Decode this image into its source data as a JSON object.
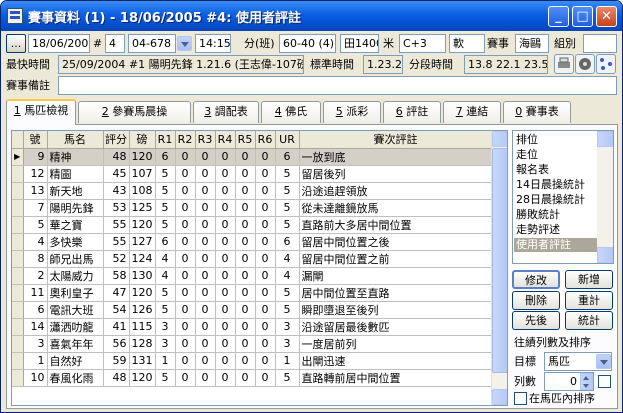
{
  "window": {
    "title": "賽事資料 (1) - 18/06/2005 #4: 使用者評註",
    "minimize": "_",
    "maximize": "□",
    "close": "✕"
  },
  "race_info": {
    "nav_button": "...",
    "date": "18/06/2005",
    "race_no_label": "#",
    "race_no": "4",
    "race_code": "04-678",
    "time": "14:15",
    "class_label": "分(班)",
    "class_value": "60-40 (4)",
    "distance": "田1400",
    "meter_label": "米",
    "course": "C+3",
    "going": "軟",
    "event_label": "賽事",
    "event_value": "海鷗",
    "group_label": "組別",
    "group_value": ""
  },
  "record": {
    "fastest_label": "最快時間",
    "fastest_value": "25/09/2004 #1 陽明先鋒 1.21.6 (王志偉-107磅)",
    "standard_label": "標準時間",
    "standard_value": "1.23.2",
    "sectional_label": "分段時間",
    "sectional_value": "13.8  22.1  23.5"
  },
  "remarks": {
    "label": "賽事備註",
    "value": ""
  },
  "tabs": [
    {
      "key": "1",
      "label": "馬匹檢視",
      "active": true
    },
    {
      "key": "2",
      "label": "參賽馬晨操",
      "active": false
    },
    {
      "key": "3",
      "label": "調配表",
      "active": false
    },
    {
      "key": "4",
      "label": "佛氏",
      "active": false
    },
    {
      "key": "5",
      "label": "派彩",
      "active": false
    },
    {
      "key": "6",
      "label": "評註",
      "active": false
    },
    {
      "key": "7",
      "label": "連結",
      "active": false
    },
    {
      "key": "0",
      "label": "賽事表",
      "active": false
    }
  ],
  "table": {
    "columns": [
      "",
      "號",
      "馬名",
      "評分",
      "磅",
      "R1",
      "R2",
      "R3",
      "R4",
      "R5",
      "R6",
      "UR",
      "賽次評註"
    ],
    "current_row_marker": "▶",
    "rows": [
      {
        "no": "9",
        "name": "精神",
        "rating": "48",
        "wt": "120",
        "r1": "6",
        "r2": "0",
        "r3": "0",
        "r4": "0",
        "r5": "0",
        "r6": "0",
        "ur": "6",
        "comment": "一放到底",
        "selected": true
      },
      {
        "no": "12",
        "name": "精圖",
        "rating": "45",
        "wt": "107",
        "r1": "5",
        "r2": "0",
        "r3": "0",
        "r4": "0",
        "r5": "0",
        "r6": "0",
        "ur": "5",
        "comment": "留居後列"
      },
      {
        "no": "13",
        "name": "新天地",
        "rating": "43",
        "wt": "108",
        "r1": "5",
        "r2": "0",
        "r3": "0",
        "r4": "0",
        "r5": "0",
        "r6": "0",
        "ur": "5",
        "comment": "沿途追趕領放"
      },
      {
        "no": "7",
        "name": "陽明先鋒",
        "rating": "53",
        "wt": "125",
        "r1": "5",
        "r2": "0",
        "r3": "0",
        "r4": "0",
        "r5": "0",
        "r6": "0",
        "ur": "5",
        "comment": "從未達離鏡放馬"
      },
      {
        "no": "5",
        "name": "華之寶",
        "rating": "55",
        "wt": "120",
        "r1": "5",
        "r2": "0",
        "r3": "0",
        "r4": "0",
        "r5": "0",
        "r6": "0",
        "ur": "5",
        "comment": "直路前大多居中間位置"
      },
      {
        "no": "4",
        "name": "多快樂",
        "rating": "55",
        "wt": "127",
        "r1": "6",
        "r2": "0",
        "r3": "0",
        "r4": "0",
        "r5": "0",
        "r6": "0",
        "ur": "6",
        "comment": "留居中間位置之後"
      },
      {
        "no": "8",
        "name": "師兄出馬",
        "rating": "52",
        "wt": "124",
        "r1": "4",
        "r2": "0",
        "r3": "0",
        "r4": "0",
        "r5": "0",
        "r6": "0",
        "ur": "4",
        "comment": "留居中間位置之前"
      },
      {
        "no": "2",
        "name": "太陽威力",
        "rating": "58",
        "wt": "130",
        "r1": "4",
        "r2": "0",
        "r3": "0",
        "r4": "0",
        "r5": "0",
        "r6": "0",
        "ur": "4",
        "comment": "漏閘"
      },
      {
        "no": "11",
        "name": "奧利皇子",
        "rating": "47",
        "wt": "120",
        "r1": "5",
        "r2": "0",
        "r3": "0",
        "r4": "0",
        "r5": "0",
        "r6": "0",
        "ur": "5",
        "comment": "居中間位置至直路"
      },
      {
        "no": "6",
        "name": "電訊大班",
        "rating": "54",
        "wt": "126",
        "r1": "5",
        "r2": "0",
        "r3": "0",
        "r4": "0",
        "r5": "0",
        "r6": "0",
        "ur": "5",
        "comment": "瞬即墮退至後列"
      },
      {
        "no": "14",
        "name": "瀟洒叻龍",
        "rating": "41",
        "wt": "115",
        "r1": "3",
        "r2": "0",
        "r3": "0",
        "r4": "0",
        "r5": "0",
        "r6": "0",
        "ur": "3",
        "comment": "沿途留居最後數匹"
      },
      {
        "no": "3",
        "name": "喜氣年年",
        "rating": "56",
        "wt": "128",
        "r1": "3",
        "r2": "0",
        "r3": "0",
        "r4": "0",
        "r5": "0",
        "r6": "0",
        "ur": "3",
        "comment": "一度居前列"
      },
      {
        "no": "1",
        "name": "自然好",
        "rating": "59",
        "wt": "131",
        "r1": "1",
        "r2": "0",
        "r3": "0",
        "r4": "0",
        "r5": "0",
        "r6": "0",
        "ur": "1",
        "comment": "出閘迅速"
      },
      {
        "no": "10",
        "name": "春風化雨",
        "rating": "48",
        "wt": "120",
        "r1": "5",
        "r2": "0",
        "r3": "0",
        "r4": "0",
        "r5": "0",
        "r6": "0",
        "ur": "5",
        "comment": "直路轉前居中間位置"
      }
    ]
  },
  "side_list": {
    "items": [
      "排位",
      "走位",
      "報名表",
      "14日晨操統計",
      "28日晨操統計",
      "勝敗統計",
      "走勢評述",
      "使用者評註"
    ],
    "selected_index": 7
  },
  "actions": {
    "edit": "修改",
    "add": "新增",
    "delete": "刪除",
    "reset": "重計",
    "first": "先後",
    "stats": "統計"
  },
  "sort": {
    "label": "往績列數及排序",
    "target_label": "目標",
    "target_value": "馬匹",
    "rows_label": "列數",
    "rows_value": "0",
    "inhorse_label": "在馬匹內排序"
  }
}
